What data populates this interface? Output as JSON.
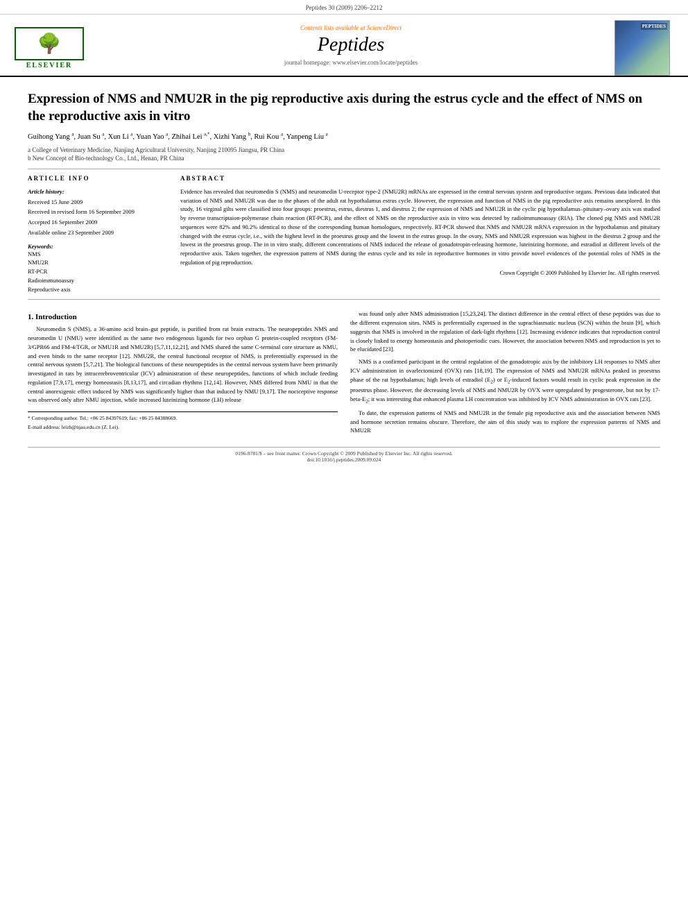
{
  "topbar": {
    "text": "Peptides 30 (2009) 2206–2212"
  },
  "header": {
    "sciencedirect_label": "Contents lists available at",
    "sciencedirect_name": "ScienceDirect",
    "journal_title": "Peptides",
    "homepage_label": "journal homepage: www.elsevier.com/locate/peptides",
    "elsevier_label": "ELSEVIER"
  },
  "article": {
    "title": "Expression of NMS and NMU2R in the pig reproductive axis during the estrus cycle and the effect of NMS on the reproductive axis in vitro",
    "authors": "Guihong Yang a, Juan Su a, Xun Li a, Yuan Yao a, Zhihai Lei a,*, Xizhi Yang b, Rui Kou a, Yanpeng Liu a",
    "affiliation_a": "a College of Veterinary Medicine, Nanjing Agricultural University, Nanjing 210095 Jiangsu, PR China",
    "affiliation_b": "b New Concept of Bio-technology Co., Ltd., Henan, PR China"
  },
  "article_info": {
    "heading": "ARTICLE INFO",
    "history_label": "Article history:",
    "received": "Received 15 June 2009",
    "received_revised": "Received in revised form 16 September 2009",
    "accepted": "Accepted 16 September 2009",
    "available": "Available online 23 September 2009",
    "keywords_label": "Keywords:",
    "keywords": [
      "NMS",
      "NMU2R",
      "RT-PCR",
      "Radioimmunoassay",
      "Reproductive axis"
    ]
  },
  "abstract": {
    "heading": "ABSTRACT",
    "text": "Evidence has revealed that neuromedin S (NMS) and neuromedin U-receptor type-2 (NMU2R) mRNAs are expressed in the central nervous system and reproductive organs. Previous data indicated that variation of NMS and NMU2R was due to the phases of the adult rat hypothalamus estrus cycle. However, the expression and function of NMS in the pig reproductive axis remains unexplored. In this study, 16 virginal gilts were classified into four groups: proestrus, estrus, diestrus 1, and diestrus 2; the expression of NMS and NMU2R in the cyclic pig hypothalamus–pituitary–ovary axis was studied by reverse transcriptaion-polymerase chain reaction (RT-PCR), and the effect of NMS on the reproductive axis in vitro was detected by radioimmunoassay (RIA). The cloned pig NMS and NMU2R sequences were 82% and 90.2% identical to those of the corresponding human homologues, respectively. RT-PCR showed that NMS and NMU2R mRNA expression in the hypothalamus and pituitary changed with the estrus cycle, i.e., with the highest level in the proestrus group and the lowest in the estrus group. In the ovary, NMS and NMU2R expression was highest in the diestrus 2 group and the lowest in the proestrus group. The in in vitro study, different concentrations of NMS induced the release of gonadotropin-releasing hormone, luteinizing hormone, and estradiol at different levels of the reproductive axis. Taken together, the expression pattern of NMS during the estrus cycle and its role in reproductive hormones in vitro provide novel evidences of the potential roles of NMS in the regulation of pig reproduction.",
    "copyright": "Crown Copyright © 2009 Published by Elsevier Inc. All rights reserved."
  },
  "section1": {
    "heading": "1. Introduction",
    "para1": "Neuromedin S (NMS), a 36-amino acid brain–gut peptide, is purified from rat brain extracts. The neuropeptides NMS and neuromedin U (NMU) were identified as the same two endogenous ligands for two orphan G protein-coupled receptors (FM-3/GPR66 and FM-4/TGR, or NMU1R and NMU2R) [5,7,11,12,21], and NMS shared the same C-terminal core structure as NMU, and even binds to the same receptor [12]. NMU2R, the central functional receptor of NMS, is preferentially expressed in the central nervous system [5,7,21]. The biological functions of these neuropeptides in the central nervous system have been primarily investigated in rats by intracerebroventricular (ICV) administration of these neuropeptides, functions of which include feeding regulation [7,9,17], energy homeostasis [8,13,17], and circadian rhythms [12,14]. However, NMS differed from NMU in that the central anorexigenic effect induced by NMS was significantly higher than that induced by NMU [9,17]. The nociceptive response was observed only after NMU injection, while increased luteinizing hormone (LH) release",
    "para2_right": "was found only after NMS administration [15,23,24]. The distinct difference in the central effect of these peptides was due to the different expression sites. NMS is preferentially expressed in the suprachiasmatic nucleus (SCN) within the brain [9], which suggests that NMS is involved in the regulation of dark-light rhythms [12]. Increasing evidence indicates that reproduction control is closely linked to energy homeostasis and photoperiodic cues. However, the association between NMS and reproduction is yet to be elucidated [23].",
    "para3_right": "NMS is a confirmed participant in the central regulation of the gonadotropic axis by the inhibitory LH responses to NMS after ICV administration in ovarlectomized (OVX) rats [18,19]. The expression of NMS and NMU2R mRNAs peaked in proestrus phase of the rat hypothalamus; high levels of estradiol (E₂) or E₂-induced factors would result in cyclic peak expression in the proestrus phase. However, the decreasing levels of NMS and NMU2R by OVX were upregulated by progesterone, but not by 17-beta-E₂; it was interesting that enhanced plasma LH concentration was inhibited by ICV NMS administration in OVX rats [23].",
    "para4_right": "To date, the expression patterns of NMS and NMU2R in the female pig reproductive axis and the association between NMS and hormone secretion remains obscure. Therefore, the aim of this study was to explore the expression patterns of NMS and NMU2R"
  },
  "footnotes": {
    "corresponding": "* Corresponding author. Tel.: +86 25 84397619; fax: +86 25 84388669.",
    "email": "E-mail address: leizh@njau.edu.cn (Z. Lei)."
  },
  "page_footer": {
    "issn": "0196-9781/$ – see front matter. Crown Copyright © 2009 Published by Elsevier Inc. All rights reserved.",
    "doi": "doi:10.1016/j.peptides.2009.09.024"
  }
}
